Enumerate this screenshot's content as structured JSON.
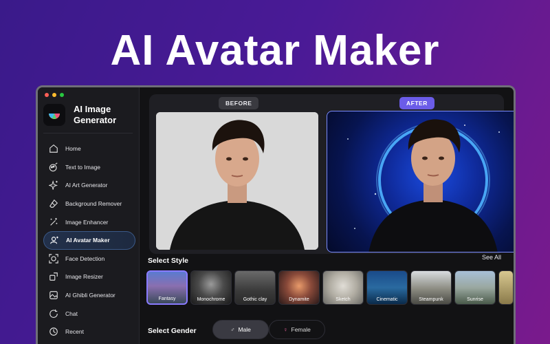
{
  "hero": {
    "title": "AI Avatar Maker"
  },
  "app": {
    "name": "AI Image Generator"
  },
  "sidebar": {
    "items": [
      {
        "label": "Home",
        "icon": "home-icon",
        "active": false
      },
      {
        "label": "Text to Image",
        "icon": "text-image-icon",
        "active": false
      },
      {
        "label": "AI Art Generator",
        "icon": "sparkles-icon",
        "active": false
      },
      {
        "label": "Background Remover",
        "icon": "eraser-icon",
        "active": false
      },
      {
        "label": "Image Enhancer",
        "icon": "magic-wand-icon",
        "active": false
      },
      {
        "label": "AI Avatar Maker",
        "icon": "avatar-icon",
        "active": true
      },
      {
        "label": "Face Detection",
        "icon": "face-scan-icon",
        "active": false
      },
      {
        "label": "Image Resizer",
        "icon": "resize-icon",
        "active": false
      },
      {
        "label": "AI Ghibli Generator",
        "icon": "ghibli-icon",
        "active": false
      },
      {
        "label": "Chat",
        "icon": "chat-icon",
        "active": false
      },
      {
        "label": "Recent",
        "icon": "history-icon",
        "active": false
      }
    ]
  },
  "compare": {
    "before_label": "BEFORE",
    "after_label": "AFTER"
  },
  "style_section": {
    "title": "Select Style",
    "see_all": "See All",
    "styles": [
      {
        "label": "Fantasy",
        "selected": true
      },
      {
        "label": "Monochrome",
        "selected": false
      },
      {
        "label": "Gothic clay",
        "selected": false
      },
      {
        "label": "Dynamite",
        "selected": false
      },
      {
        "label": "Sketch",
        "selected": false
      },
      {
        "label": "Cinematic",
        "selected": false
      },
      {
        "label": "Steampunk",
        "selected": false
      },
      {
        "label": "Sunrise",
        "selected": false
      }
    ]
  },
  "gender_section": {
    "title": "Select Gender",
    "options": [
      {
        "label": "Male",
        "icon": "male-symbol-icon",
        "selected": true
      },
      {
        "label": "Female",
        "icon": "female-symbol-icon",
        "selected": false
      }
    ]
  },
  "colors": {
    "accent": "#6b5ce8",
    "background": "#4a1a96",
    "window": "#121214"
  }
}
